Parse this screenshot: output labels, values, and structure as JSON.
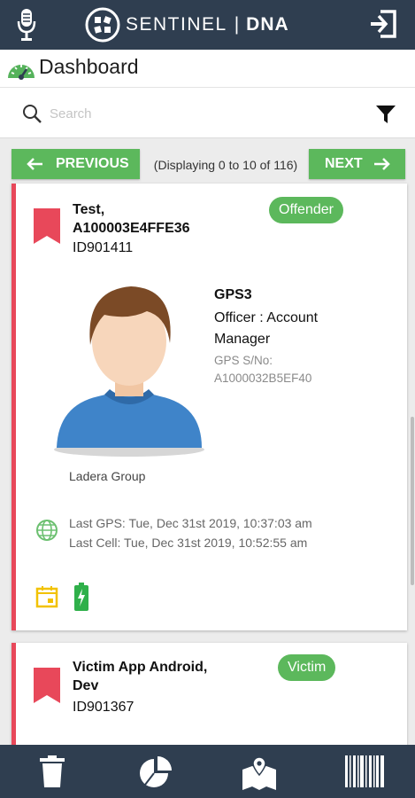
{
  "header": {
    "logo_text": "SENTINEL",
    "logo_sep": "|",
    "logo_dna": "DNA"
  },
  "page": {
    "title": "Dashboard"
  },
  "search": {
    "placeholder": "Search"
  },
  "pagination": {
    "prev_label": "PREVIOUS",
    "next_label": "NEXT",
    "display_text": "(Displaying 0 to 10 of 116)"
  },
  "records": [
    {
      "name_line1": "Test,",
      "name_line2": "A100003E4FFE36",
      "id": "ID901411",
      "badge": "Offender",
      "device": "GPS3",
      "officer": "Officer : Account Manager",
      "serial_label": "GPS S/No:",
      "serial": "A1000032B5EF40",
      "group": "Ladera Group",
      "last_gps": "Last GPS: Tue, Dec 31st 2019, 10:37:03 am",
      "last_cell": "Last Cell: Tue, Dec 31st 2019, 10:52:55 am"
    },
    {
      "name_line1": "Victim App Android,",
      "name_line2": "Dev",
      "id": "ID901367",
      "badge": "Victim"
    }
  ],
  "colors": {
    "topbar": "#2f3e50",
    "accent_green": "#5cb85c",
    "card_stripe": "#e8485a",
    "bookmark": "#e8485a",
    "calendar": "#f2c200",
    "battery": "#2fb04a"
  },
  "icons": [
    "microphone-icon",
    "logo-icon",
    "logout-icon",
    "gauge-icon",
    "search-icon",
    "filter-icon",
    "bookmark-icon",
    "avatar-icon",
    "globe-icon",
    "calendar-icon",
    "battery-icon",
    "trash-icon",
    "pie-chart-icon",
    "map-icon",
    "barcode-icon"
  ]
}
